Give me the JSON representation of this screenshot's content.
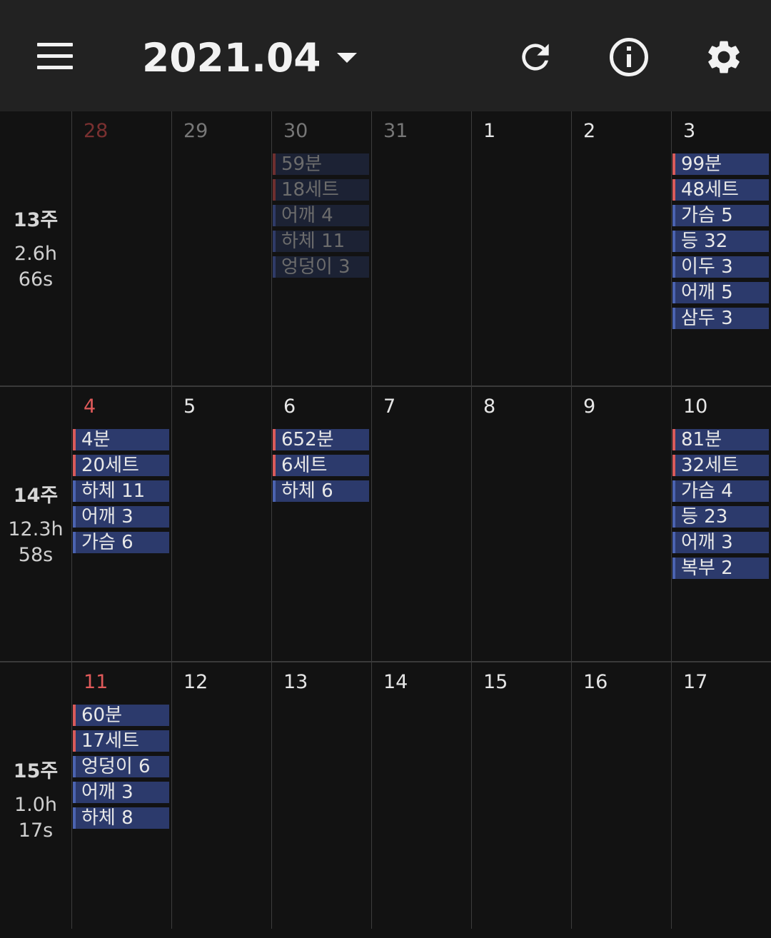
{
  "header": {
    "title": "2021.04",
    "icons": [
      "menu-icon",
      "refresh-icon",
      "info-icon",
      "settings-icon"
    ]
  },
  "colors": {
    "background": "#121212",
    "topbar": "#222222",
    "chip_fill": "#2c3a6c",
    "chip_accent_blue": "#4b63b0",
    "chip_accent_red": "#d85b5b",
    "sunday": "#e05a5a"
  },
  "weeks": [
    {
      "label": "13주",
      "hours": "2.6h",
      "seconds": "66s",
      "days": [
        {
          "num": "28",
          "sunday": true,
          "prev": true,
          "chips": []
        },
        {
          "num": "29",
          "prev": true,
          "chips": []
        },
        {
          "num": "30",
          "prev": true,
          "chips": [
            {
              "text": "59분",
              "red": true
            },
            {
              "text": "18세트",
              "red": true
            },
            {
              "text": "어깨 4"
            },
            {
              "text": "하체 11"
            },
            {
              "text": "엉덩이 3"
            }
          ]
        },
        {
          "num": "31",
          "prev": true,
          "chips": []
        },
        {
          "num": "1",
          "chips": []
        },
        {
          "num": "2",
          "chips": []
        },
        {
          "num": "3",
          "chips": [
            {
              "text": "99분",
              "red": true
            },
            {
              "text": "48세트",
              "red": true
            },
            {
              "text": "가슴 5"
            },
            {
              "text": "등 32"
            },
            {
              "text": "이두 3"
            },
            {
              "text": "어깨 5"
            },
            {
              "text": "삼두 3"
            }
          ]
        }
      ]
    },
    {
      "label": "14주",
      "hours": "12.3h",
      "seconds": "58s",
      "days": [
        {
          "num": "4",
          "sunday": true,
          "chips": [
            {
              "text": "4분",
              "red": true
            },
            {
              "text": "20세트",
              "red": true
            },
            {
              "text": "하체 11"
            },
            {
              "text": "어깨 3"
            },
            {
              "text": "가슴 6"
            }
          ]
        },
        {
          "num": "5",
          "chips": []
        },
        {
          "num": "6",
          "chips": [
            {
              "text": "652분",
              "red": true
            },
            {
              "text": "6세트",
              "red": true
            },
            {
              "text": "하체 6"
            }
          ]
        },
        {
          "num": "7",
          "chips": []
        },
        {
          "num": "8",
          "chips": []
        },
        {
          "num": "9",
          "chips": []
        },
        {
          "num": "10",
          "chips": [
            {
              "text": "81분",
              "red": true
            },
            {
              "text": "32세트",
              "red": true
            },
            {
              "text": "가슴 4"
            },
            {
              "text": "등 23"
            },
            {
              "text": "어깨 3"
            },
            {
              "text": "복부 2"
            }
          ]
        }
      ]
    },
    {
      "label": "15주",
      "hours": "1.0h",
      "seconds": "17s",
      "days": [
        {
          "num": "11",
          "sunday": true,
          "chips": [
            {
              "text": "60분",
              "red": true
            },
            {
              "text": "17세트",
              "red": true
            },
            {
              "text": "엉덩이 6"
            },
            {
              "text": "어깨 3"
            },
            {
              "text": "하체 8"
            }
          ]
        },
        {
          "num": "12",
          "chips": []
        },
        {
          "num": "13",
          "chips": []
        },
        {
          "num": "14",
          "chips": []
        },
        {
          "num": "15",
          "chips": []
        },
        {
          "num": "16",
          "chips": []
        },
        {
          "num": "17",
          "chips": []
        }
      ]
    }
  ]
}
